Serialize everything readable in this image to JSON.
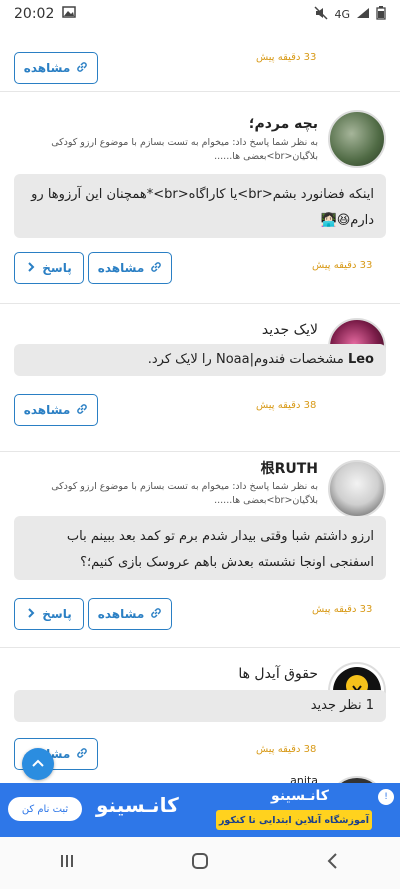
{
  "status_bar": {
    "time": "20:02",
    "network": "4G"
  },
  "feed": [
    {
      "buttons": {
        "view": "مشاهده"
      },
      "time": "33 دقیقه پیش"
    },
    {
      "name": "بچه مردم؛",
      "sub": "به نظر شما پاسخ داد: میخوام به تست بسازم با موضوع ارزو کودکی بلاگیان<br>بعضی ها......",
      "bubble": "اینکه فضانورد بشم<br>یا کاراگاه<br>*همچنان این آرزوها رو دارم😆👩🏻‍💻",
      "buttons": {
        "reply": "پاسخ",
        "view": "مشاهده"
      },
      "time": "33 دقیقه پیش"
    },
    {
      "name": "لایک جدید",
      "bubble_bold": "Leo",
      "bubble": " مشخصات فندوم|Noaa را لایک کرد.",
      "buttons": {
        "view": "مشاهده"
      },
      "time": "38 دقیقه پیش"
    },
    {
      "name": "根RUTH",
      "sub": "به نظر شما پاسخ داد: میخوام به تست بسازم با موضوع ارزو کودکی بلاگیان<br>بعضی ها......",
      "bubble": "ارزو داشتم شبا وقتی بیدار شدم برم تو کمد بعد ببینم باب اسفنجی اونجا نشسته بعدش باهم عروسک بازی کنیم؛؟",
      "buttons": {
        "reply": "پاسخ",
        "view": "مشاهده"
      },
      "time": "33 دقیقه پیش"
    },
    {
      "name": "حقوق آیدل ها",
      "bubble": "1 نظر جدید",
      "buttons": {
        "view": "مشاهده"
      },
      "time": "38 دقیقه پیش"
    },
    {
      "name": "anjta"
    }
  ],
  "banner": {
    "signup": "ثبت نام کن",
    "logo": "کانـسینو",
    "logo_small": "کانـسینو",
    "tagline": "آموزشگاه آنلاین ابتدایی تا کنکور",
    "accent": "#2e77e8",
    "tag_color": "#ffd21e"
  },
  "colors": {
    "button": "#2a7fc4",
    "time": "#d89a18",
    "bubble": "#e9e9e9"
  }
}
